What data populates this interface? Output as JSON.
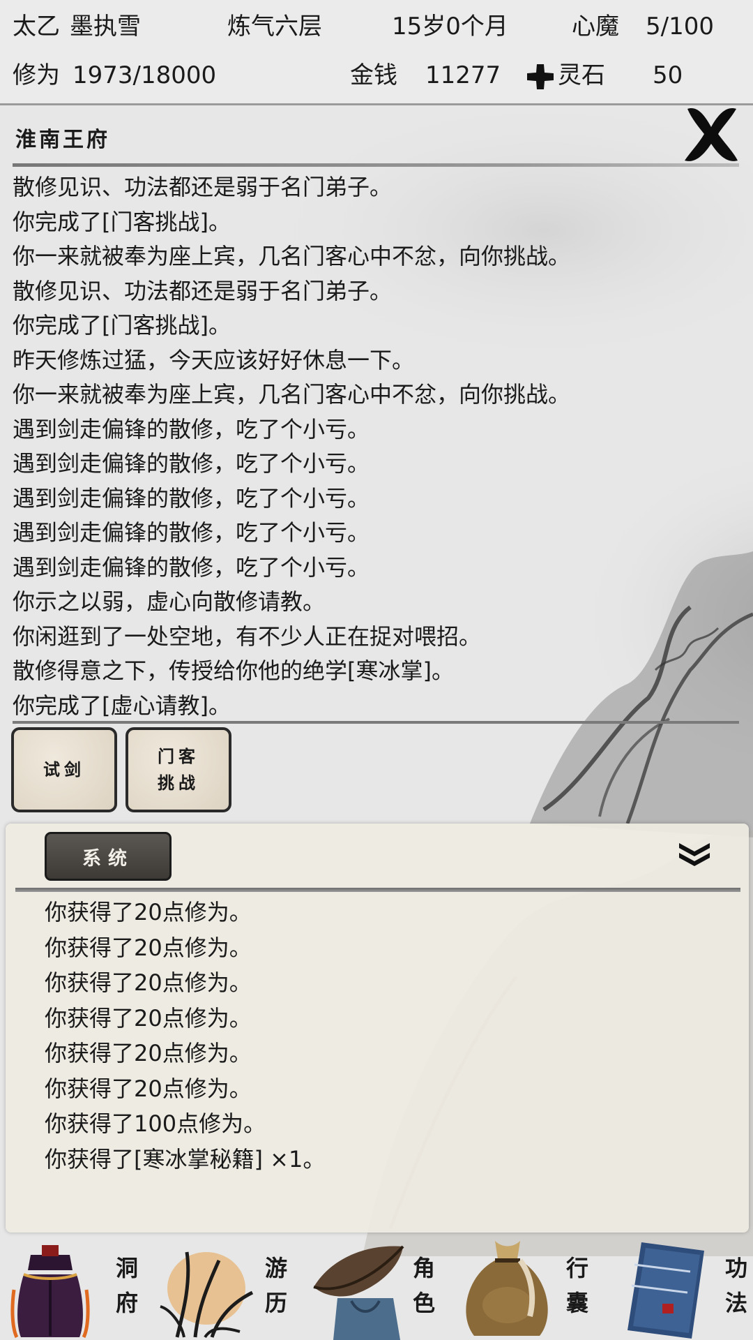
{
  "stats": {
    "sect": "太乙",
    "name": "墨执雪",
    "realm": "炼气六层",
    "age": "15岁0个月",
    "heart_demon_label": "心魔",
    "heart_demon_value": "5/100",
    "cultivation_label": "修为",
    "cultivation_value": "1973/18000",
    "money_label": "金钱",
    "money_value": "11277",
    "spirit_stone_label": "灵石",
    "spirit_stone_value": "50"
  },
  "location": {
    "title": "淮南王府"
  },
  "event_log": [
    "散修见识、功法都还是弱于名门弟子。",
    "你完成了[门客挑战]。",
    "你一来就被奉为座上宾，几名门客心中不忿，向你挑战。",
    "散修见识、功法都还是弱于名门弟子。",
    "你完成了[门客挑战]。",
    "昨天修炼过猛，今天应该好好休息一下。",
    "你一来就被奉为座上宾，几名门客心中不忿，向你挑战。",
    "遇到剑走偏锋的散修，吃了个小亏。",
    "遇到剑走偏锋的散修，吃了个小亏。",
    "遇到剑走偏锋的散修，吃了个小亏。",
    "遇到剑走偏锋的散修，吃了个小亏。",
    "遇到剑走偏锋的散修，吃了个小亏。",
    "你示之以弱，虚心向散修请教。",
    "你闲逛到了一处空地，有不少人正在捉对喂招。",
    "散修得意之下，传授给你他的绝学[寒冰掌]。",
    "你完成了[虚心请教]。"
  ],
  "actions": {
    "trial_sword": "试剑",
    "retainer_line1": "门客",
    "retainer_line2": "挑战"
  },
  "system_panel": {
    "tab_label": "系统",
    "messages": [
      "你获得了20点修为。",
      "你获得了20点修为。",
      "你获得了20点修为。",
      "你获得了20点修为。",
      "你获得了20点修为。",
      "你获得了20点修为。",
      "你获得了100点修为。",
      "你获得了[寒冰掌秘籍] ×1。"
    ]
  },
  "nav": {
    "cave": [
      "洞",
      "府"
    ],
    "travel": [
      "游",
      "历"
    ],
    "character": [
      "角",
      "色"
    ],
    "bag": [
      "行",
      "囊"
    ],
    "skills": [
      "功",
      "法"
    ]
  },
  "colors": {
    "ink": "#1a1a1a",
    "panel_bg": "#eeebe2",
    "tab_dark": "#4a4742",
    "button_paper": "#e6dece",
    "divider": "#7a7a7a"
  }
}
